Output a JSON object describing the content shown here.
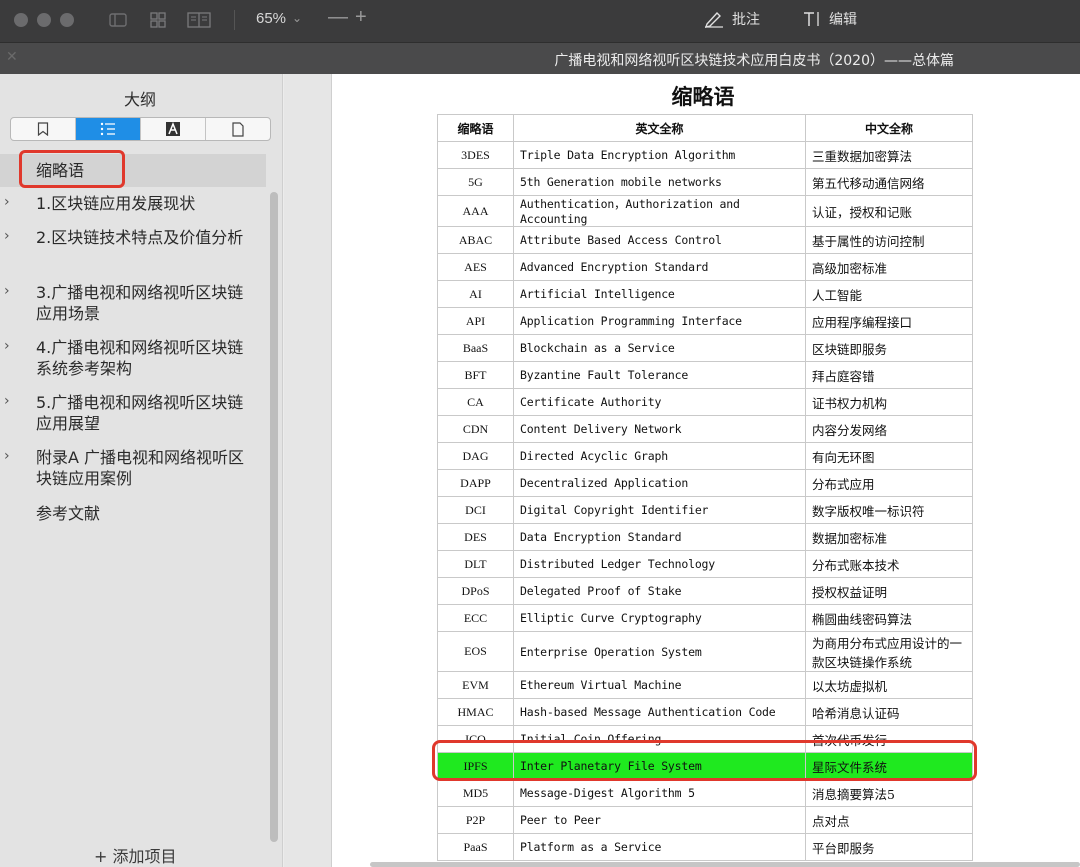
{
  "toolbar": {
    "zoom": "65%",
    "zoom_minus": "—",
    "zoom_plus": "+",
    "annotate_label": "批注",
    "edit_label": "编辑"
  },
  "document_title": "广播电视和网络视听区块链技术应用白皮书（2020）——总体篇",
  "sidebar": {
    "title": "大纲",
    "tabs": [
      "bookmark-icon",
      "outline-icon",
      "annotation-icon",
      "page-icon"
    ],
    "active_tab": "outline-icon",
    "items": [
      {
        "label": "缩略语",
        "expandable": false,
        "selected": true
      },
      {
        "label": "1.区块链应用发展现状",
        "expandable": true
      },
      {
        "label": "2.区块链技术特点及价值分析",
        "expandable": true
      },
      {
        "label": "3.广播电视和网络视听区块链应用场景",
        "expandable": true
      },
      {
        "label": "4.广播电视和网络视听区块链系统参考架构",
        "expandable": true
      },
      {
        "label": "5.广播电视和网络视听区块链应用展望",
        "expandable": true
      },
      {
        "label": "附录A 广播电视和网络视听区块链应用案例",
        "expandable": true
      },
      {
        "label": "参考文献",
        "expandable": false
      }
    ],
    "add_item": "+ 添加项目"
  },
  "page": {
    "title": "缩略语",
    "table": {
      "headers": [
        "缩略语",
        "英文全称",
        "中文全称"
      ],
      "rows": [
        [
          "3DES",
          "Triple Data Encryption Algorithm",
          "三重数据加密算法"
        ],
        [
          "5G",
          "5th Generation mobile networks",
          "第五代移动通信网络"
        ],
        [
          "AAA",
          "Authentication，Authorization and Accounting",
          "认证，授权和记账"
        ],
        [
          "ABAC",
          "Attribute Based Access Control",
          "基于属性的访问控制"
        ],
        [
          "AES",
          "Advanced Encryption Standard",
          "高级加密标准"
        ],
        [
          "AI",
          "Artificial Intelligence",
          "人工智能"
        ],
        [
          "API",
          "Application Programming Interface",
          "应用程序编程接口"
        ],
        [
          "BaaS",
          "Blockchain as a Service",
          "区块链即服务"
        ],
        [
          "BFT",
          "Byzantine Fault Tolerance",
          "拜占庭容错"
        ],
        [
          "CA",
          "Certificate Authority",
          "证书权力机构"
        ],
        [
          "CDN",
          "Content Delivery Network",
          "内容分发网络"
        ],
        [
          "DAG",
          "Directed Acyclic Graph",
          "有向无环图"
        ],
        [
          "DAPP",
          "Decentralized Application",
          "分布式应用"
        ],
        [
          "DCI",
          "Digital Copyright Identifier",
          "数字版权唯一标识符"
        ],
        [
          "DES",
          "Data Encryption Standard",
          "数据加密标准"
        ],
        [
          "DLT",
          "Distributed Ledger Technology",
          "分布式账本技术"
        ],
        [
          "DPoS",
          "Delegated Proof of Stake",
          "授权权益证明"
        ],
        [
          "ECC",
          "Elliptic Curve Cryptography",
          "椭圆曲线密码算法"
        ],
        [
          "EOS",
          "Enterprise Operation System",
          "为商用分布式应用设计的一款区块链操作系统"
        ],
        [
          "EVM",
          "Ethereum Virtual Machine",
          "以太坊虚拟机"
        ],
        [
          "HMAC",
          "Hash-based Message Authentication Code",
          "哈希消息认证码"
        ],
        [
          "ICO",
          "Initial Coin Offering",
          "首次代币发行"
        ],
        [
          "IPFS",
          "Inter Planetary File System",
          "星际文件系统"
        ],
        [
          "MD5",
          "Message-Digest Algorithm 5",
          "消息摘要算法5"
        ],
        [
          "P2P",
          "Peer to Peer",
          "点对点"
        ],
        [
          "PaaS",
          "Platform as a Service",
          "平台即服务"
        ]
      ],
      "highlighted_row": "IPFS",
      "highlight_color": "#1fe91f",
      "callout_color": "#e0382c"
    }
  }
}
